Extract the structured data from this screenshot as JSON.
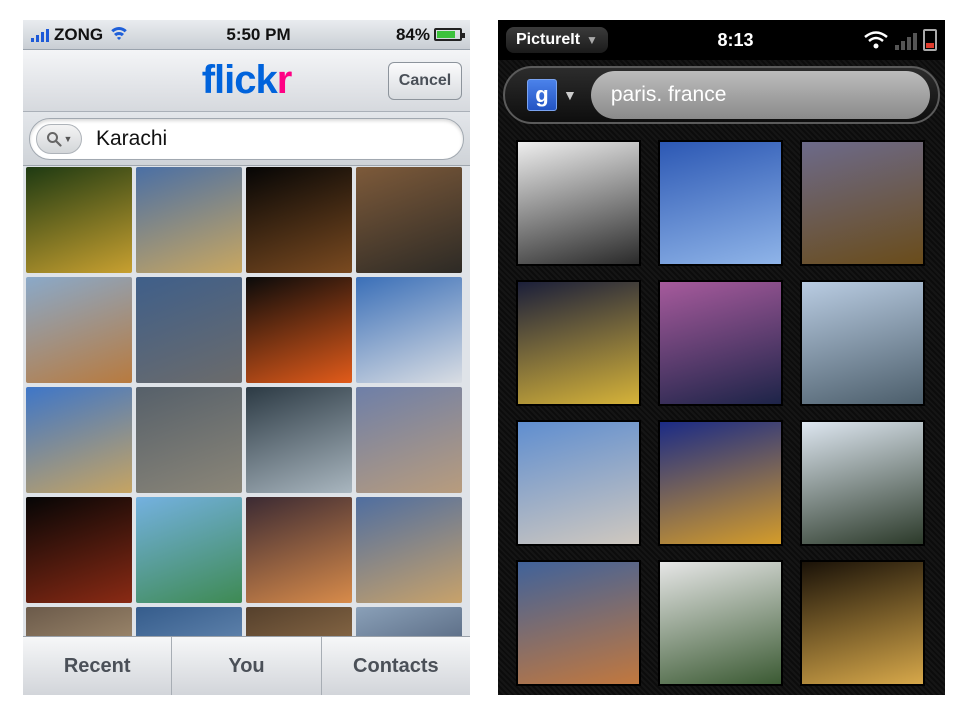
{
  "left_phone": {
    "status": {
      "carrier": "ZONG",
      "time": "5:50 PM",
      "battery": "84%"
    },
    "header": {
      "logo_blue": "flick",
      "logo_pink": "r",
      "cancel_label": "Cancel"
    },
    "search": {
      "value": "Karachi"
    },
    "tabs": [
      {
        "label": "Recent"
      },
      {
        "label": "You"
      },
      {
        "label": "Contacts"
      }
    ],
    "thumbnails": [
      {
        "c1": "#1e3a12",
        "c2": "#c8a030"
      },
      {
        "c1": "#4a6fa5",
        "c2": "#c9a760"
      },
      {
        "c1": "#050505",
        "c2": "#7a4a20"
      },
      {
        "c1": "#7d5a3a",
        "c2": "#2d2a25"
      },
      {
        "c1": "#8aa9c9",
        "c2": "#b87a3e"
      },
      {
        "c1": "#3f5f8a",
        "c2": "#6b6b6b"
      },
      {
        "c1": "#0a0a0a",
        "c2": "#e25b1a"
      },
      {
        "c1": "#3a6fb8",
        "c2": "#d9dde3"
      },
      {
        "c1": "#3e76c8",
        "c2": "#c6a462"
      },
      {
        "c1": "#56606a",
        "c2": "#8b8678"
      },
      {
        "c1": "#2c3a44",
        "c2": "#a9b6bf"
      },
      {
        "c1": "#6e7fa8",
        "c2": "#b89c7d"
      },
      {
        "c1": "#050505",
        "c2": "#8a2a14"
      },
      {
        "c1": "#74b1e0",
        "c2": "#3e8a53"
      },
      {
        "c1": "#3b2a33",
        "c2": "#d88b4a"
      },
      {
        "c1": "#4f6ea0",
        "c2": "#c8a26a"
      },
      {
        "c1": "#6b5a4a",
        "c2": "#c9b08a"
      },
      {
        "c1": "#355c8c",
        "c2": "#87a7c9"
      },
      {
        "c1": "#55402c",
        "c2": "#b38a5b"
      },
      {
        "c1": "#8aa0b8",
        "c2": "#2f3c55"
      }
    ]
  },
  "right_phone": {
    "status": {
      "app_name": "PictureIt",
      "time": "8:13"
    },
    "search": {
      "engine_letter": "g",
      "value": "paris. france"
    },
    "photos": [
      {
        "c1": "#eeeeee",
        "c2": "#2a2a2a"
      },
      {
        "c1": "#2c58b4",
        "c2": "#8fb4e8"
      },
      {
        "c1": "#6c6a8a",
        "c2": "#6a4c1a"
      },
      {
        "c1": "#1b1f3a",
        "c2": "#d6b339"
      },
      {
        "c1": "#a65a9c",
        "c2": "#1d2448"
      },
      {
        "c1": "#b9cce2",
        "c2": "#4c5e6b"
      },
      {
        "c1": "#5f8ed0",
        "c2": "#cfc8bf"
      },
      {
        "c1": "#1b2b86",
        "c2": "#d49c2a"
      },
      {
        "c1": "#dde6f0",
        "c2": "#2c3a2a"
      },
      {
        "c1": "#40629a",
        "c2": "#c2783e"
      },
      {
        "c1": "#e6e6e6",
        "c2": "#3b5a33"
      },
      {
        "c1": "#1a1208",
        "c2": "#d7a84a"
      }
    ]
  }
}
